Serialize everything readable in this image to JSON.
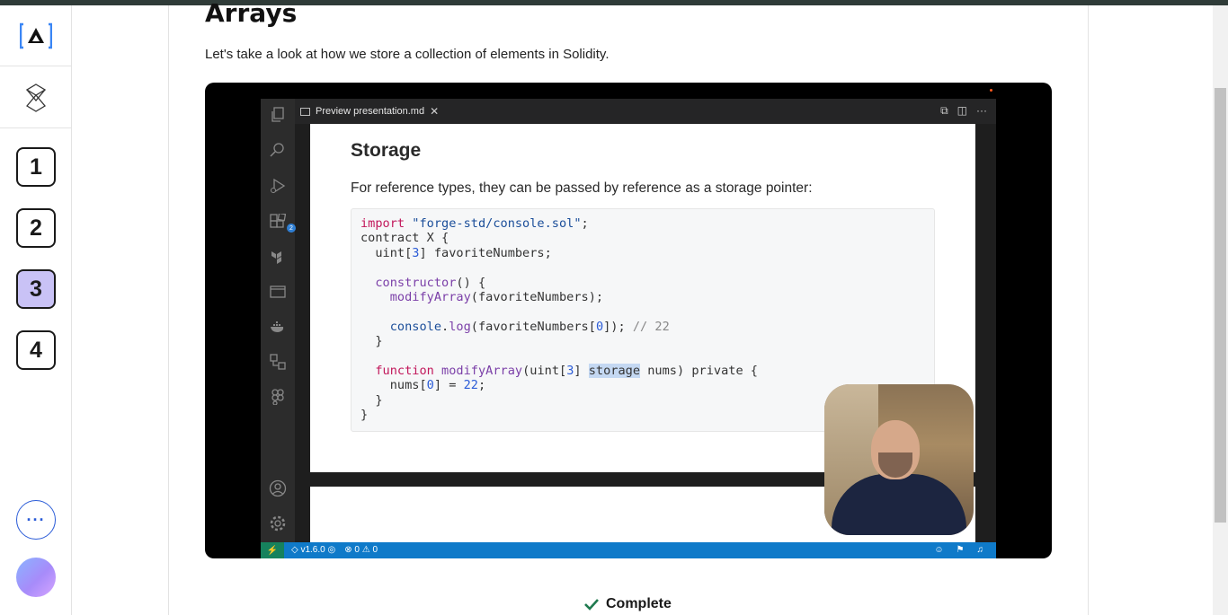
{
  "sidebar": {
    "logo": "[A]",
    "steps": [
      {
        "label": "1",
        "active": false
      },
      {
        "label": "2",
        "active": false
      },
      {
        "label": "3",
        "active": true
      },
      {
        "label": "4",
        "active": false
      }
    ],
    "more_label": "···"
  },
  "lesson": {
    "title": "Arrays",
    "intro": "Let's take a look at how we store a collection of elements in Solidity."
  },
  "video": {
    "tab_label": "Preview presentation.md",
    "extensions_badge": "2",
    "slide_title": "Storage",
    "slide_text": "For reference types, they can be passed by reference as a storage pointer:",
    "status": {
      "version": "v1.6.0",
      "errors": "0",
      "warnings": "0"
    }
  },
  "footer": {
    "complete_label": "Complete"
  },
  "colors": {
    "active_step": "#c9c2f6",
    "accent_blue": "#2a5bd7",
    "statusbar": "#0f7ac9"
  }
}
